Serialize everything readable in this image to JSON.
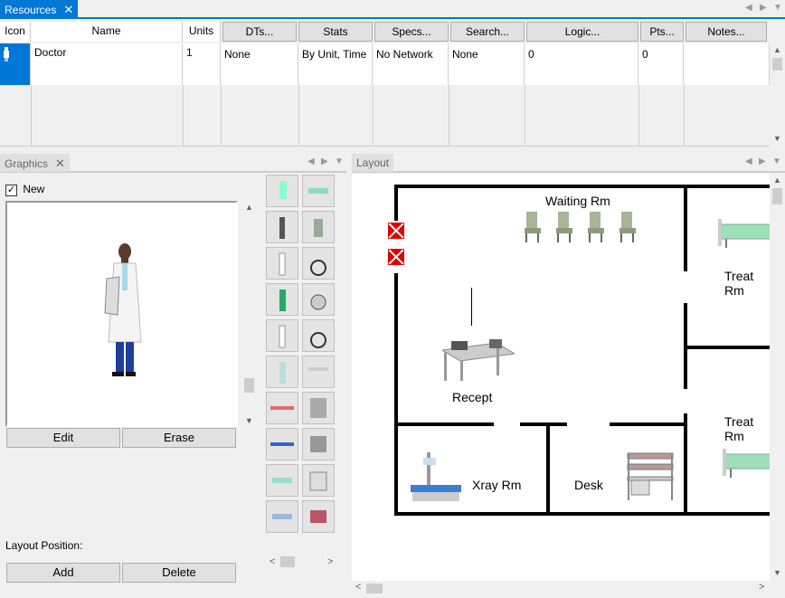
{
  "top_tab": {
    "label": "Resources",
    "close": "✕"
  },
  "columns": [
    {
      "key": "icon",
      "label": "Icon"
    },
    {
      "key": "name",
      "label": "Name"
    },
    {
      "key": "units",
      "label": "Units"
    },
    {
      "key": "dts",
      "label": "DTs..."
    },
    {
      "key": "stats",
      "label": "Stats"
    },
    {
      "key": "specs",
      "label": "Specs..."
    },
    {
      "key": "search",
      "label": "Search..."
    },
    {
      "key": "logic",
      "label": "Logic..."
    },
    {
      "key": "pts",
      "label": "Pts..."
    },
    {
      "key": "notes",
      "label": "Notes..."
    }
  ],
  "row": {
    "name": "Doctor",
    "units": "1",
    "dts": "None",
    "stats": "By Unit, Time",
    "specs": "No Network",
    "search": "None",
    "logic": "0",
    "pts": "0",
    "notes": ""
  },
  "graphics": {
    "tab": "Graphics",
    "close": "✕",
    "new_label": "New",
    "new_checked": true,
    "edit_label": "Edit",
    "erase_label": "Erase",
    "layout_position_label": "Layout Position:",
    "add_label": "Add",
    "delete_label": "Delete"
  },
  "layout": {
    "tab": "Layout",
    "rooms": {
      "waiting": "Waiting Rm",
      "treat_top": "Treat Rm",
      "treat_bottom": "Treat Rm",
      "recept": "Recept",
      "xray": "Xray Rm",
      "desk": "Desk"
    }
  },
  "colors": {
    "accent": "#0078d7",
    "wall": "#000000",
    "door": "#e00000"
  }
}
